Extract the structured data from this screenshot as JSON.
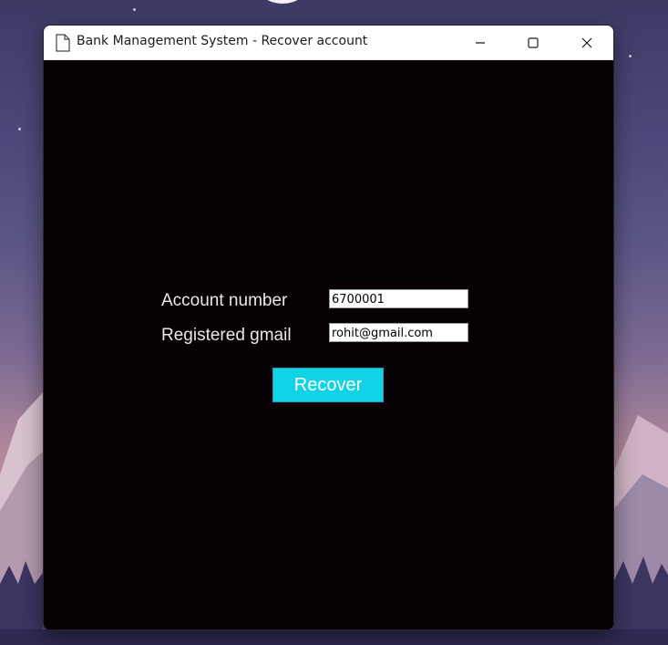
{
  "window": {
    "title": "Bank Management System - Recover account",
    "icon": "document-icon",
    "controls": {
      "minimize_icon": "minimize-icon",
      "maximize_icon": "maximize-icon",
      "close_icon": "close-icon"
    }
  },
  "form": {
    "account_number": {
      "label": "Account number",
      "value": "6700001"
    },
    "registered_gmail": {
      "label": "Registered gmail",
      "value": "rohit@gmail.com"
    },
    "recover_button": {
      "label": "Recover"
    }
  },
  "colors": {
    "window_background": "#070003",
    "button_accent": "#12d2e6",
    "label_text": "#e8e8e8"
  }
}
